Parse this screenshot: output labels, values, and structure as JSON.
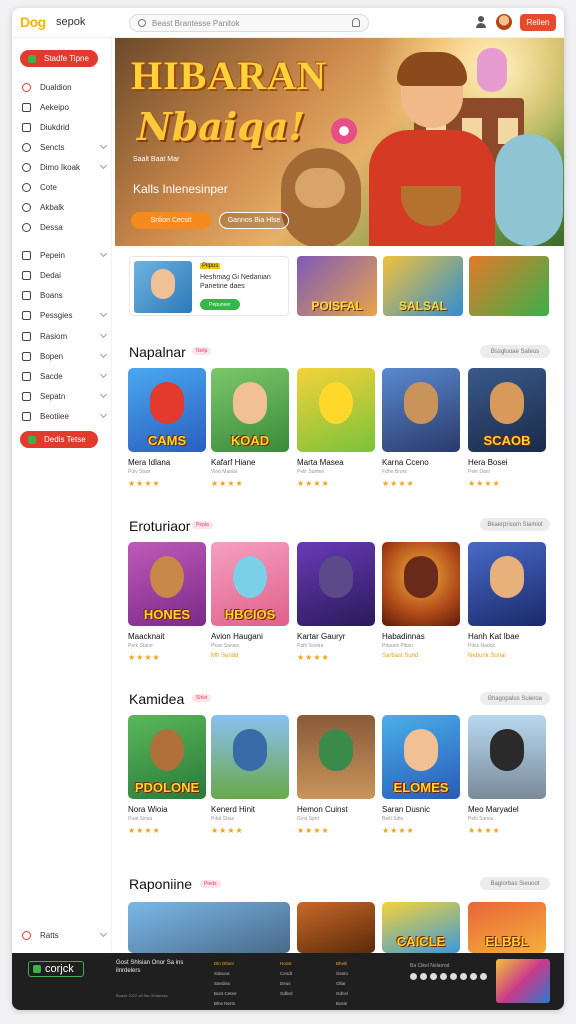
{
  "header": {
    "logo": "Dog",
    "brand": "sepok",
    "search_placeholder": "Beast Brantesse Panitok",
    "button": "Rellen"
  },
  "sidebar": {
    "cta_top": "Stadfe Tipne",
    "group1": [
      {
        "label": "Dualdion",
        "icon": "record-icon"
      },
      {
        "label": "Aekeipo",
        "icon": "chart-icon"
      },
      {
        "label": "Diukdrid",
        "icon": "pen-icon"
      },
      {
        "label": "Sencts",
        "icon": "settings-icon"
      },
      {
        "label": "Dimo Ikoak",
        "icon": "clock-icon"
      },
      {
        "label": "Cote",
        "icon": "circle-icon"
      },
      {
        "label": "Akbalk",
        "icon": "globe-icon"
      },
      {
        "label": "Dessa",
        "icon": "target-icon"
      }
    ],
    "group2": [
      {
        "label": "Pepein",
        "icon": "box-icon"
      },
      {
        "label": "Dedai",
        "icon": "box-icon"
      },
      {
        "label": "Boans",
        "icon": "layers-icon"
      },
      {
        "label": "Pessgies",
        "icon": "grid-icon"
      },
      {
        "label": "Rasiom",
        "icon": "box-icon"
      },
      {
        "label": "Bopen",
        "icon": "box-icon"
      },
      {
        "label": "Sacde",
        "icon": "box-icon"
      },
      {
        "label": "Sepatn",
        "icon": "box-icon"
      },
      {
        "label": "Beotiiee",
        "icon": "box-icon"
      }
    ],
    "cta_bottom": "Dedis Tetse",
    "bottom_item": "Ratts"
  },
  "hero": {
    "title": "HIBARAN",
    "script": "Nbaiqa!",
    "small": "Saalt Baat Mar",
    "subtitle": "Kalls Inlenesinper",
    "btn_primary": "Snlion Cecsit",
    "btn_secondary": "Gannos Bia Hlse"
  },
  "promo": {
    "badge": "Piipus",
    "title": "Heshmag Gi Nedanian Panetine daes",
    "button": "Pepuneer",
    "thumbs": [
      "POISFAL",
      "SALSAL",
      ""
    ]
  },
  "sections": [
    {
      "title": "Napalnar",
      "tag": "Neilp",
      "see_all": "Bssgluoae Sateus",
      "cards": [
        {
          "name": "Mera Idlana",
          "sub": "Pulv Stasr",
          "label": "CAMS",
          "rating": "★★★★"
        },
        {
          "name": "Kafarf Hiane",
          "sub": "Vino Manlar",
          "label": "KOAD",
          "rating": "★★★★"
        },
        {
          "name": "Marta Masea",
          "sub": "Pelir Sunten",
          "label": "",
          "rating": "★★★★"
        },
        {
          "name": "Karna Cceno",
          "sub": "Fdhe Brunt",
          "label": "",
          "rating": "★★★★"
        },
        {
          "name": "Hera Bosei",
          "sub": "Pelir Danl",
          "label": "SCAOB",
          "rating": "★★★★"
        }
      ]
    },
    {
      "title": "Eroturiaor",
      "tag": "Pepla",
      "see_all": "Bkaerprisom Siamiot",
      "cards": [
        {
          "name": "Maacknait",
          "sub": "Perk Stane",
          "label": "HONES",
          "rating": "★★★★"
        },
        {
          "name": "Avion Haugani",
          "sub": "Pkan Sanias",
          "label": "HBCIOS",
          "rating": "Mh Sundd"
        },
        {
          "name": "Kartar Gauryr",
          "sub": "Pafn Sontra",
          "label": "",
          "rating": "★★★★"
        },
        {
          "name": "Habadinnas",
          "sub": "Pdaunk Pikan",
          "label": "",
          "rating": "Sarbast Sund"
        },
        {
          "name": "Hanh Kat Ibae",
          "sub": "Pdss Naduk",
          "label": "",
          "rating": "Nebunk Sunal"
        }
      ]
    },
    {
      "title": "Kamidea",
      "tag": "Shlet",
      "see_all": "Bhagopalus Suieroa",
      "cards": [
        {
          "name": "Nora Wioia",
          "sub": "Puat Sinsa",
          "label": "PDOLONE",
          "rating": "★★★★"
        },
        {
          "name": "Kenerd Hinit",
          "sub": "Pdat Sbas",
          "label": "",
          "rating": "★★★★"
        },
        {
          "name": "Hemon Cuinst",
          "sub": "Gvst Spnt",
          "label": "",
          "rating": "★★★★"
        },
        {
          "name": "Saran Dusnic",
          "sub": "Beltl Sdts",
          "label": "ELOMES",
          "rating": "★★★★"
        },
        {
          "name": "Meo Maryadel",
          "sub": "Pelti Sumia",
          "label": "",
          "rating": "★★★★"
        }
      ]
    },
    {
      "title": "Raponiine",
      "tag": "Pieds",
      "see_all": "Bagiorbas Sieuoot",
      "cards": [
        {
          "name": "",
          "sub": "",
          "label": "",
          "rating": ""
        },
        {
          "name": "",
          "sub": "",
          "label": "",
          "rating": ""
        },
        {
          "name": "",
          "sub": "",
          "label": "",
          "rating": ""
        },
        {
          "name": "",
          "sub": "",
          "label": "CAICLE",
          "rating": ""
        },
        {
          "name": "",
          "sub": "",
          "label": "ELBBL",
          "rating": ""
        }
      ]
    }
  ],
  "footer": {
    "logo": "corjck",
    "tagline": "Gost Shlsian Onor Sa ins ilnrdelers",
    "copyright": "Buads 2022 all flar Gbdarsas",
    "col1": [
      "Dlo Dtlanr",
      "Sdeuoa",
      "Sandiss",
      "Bunt Cetee",
      "Blne Nerts"
    ],
    "col2": [
      "Hosst",
      "Cendt",
      "Deus",
      "Gdbrd"
    ],
    "col3": [
      "Bhetli",
      "Gesto",
      "Ollar",
      "Gdnsl",
      "Bosie"
    ],
    "top_text": "Ba Ctkel Nelarrod"
  }
}
